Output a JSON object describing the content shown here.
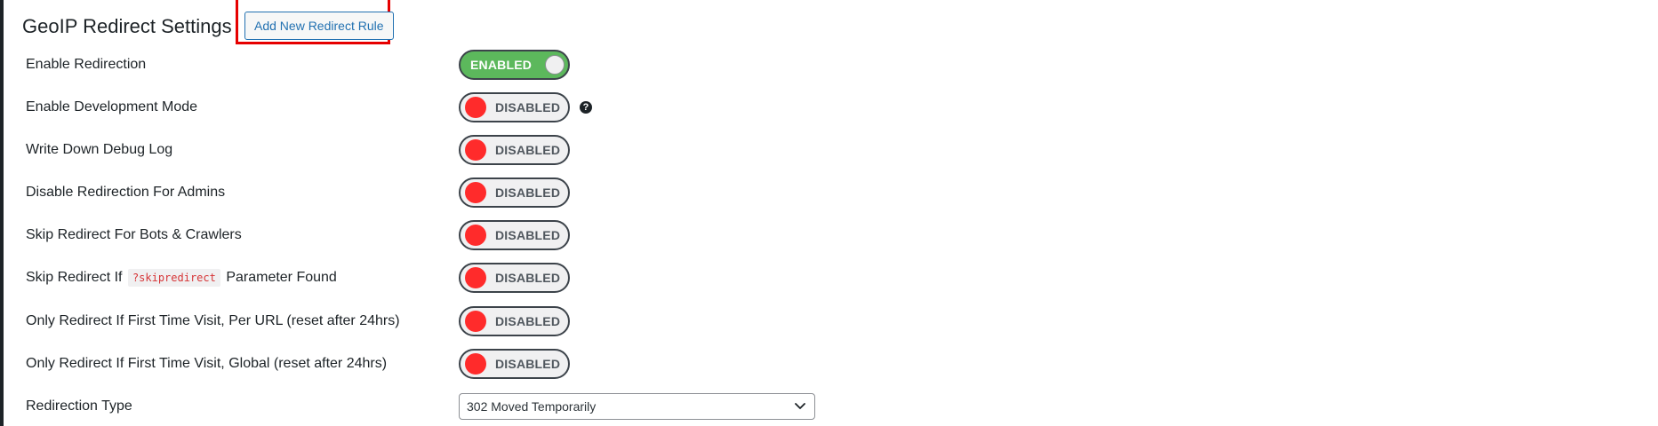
{
  "header": {
    "title": "GeoIP Redirect Settings",
    "add_rule_label": "Add New Redirect Rule"
  },
  "colors": {
    "enabled_toggle": "#5cb85c",
    "disabled_knob": "#ff2b2b",
    "highlight_box": "#e60000",
    "link_blue": "#2271b1"
  },
  "settings": {
    "enable_redirection": {
      "label": "Enable Redirection",
      "state": "ENABLED"
    },
    "development_mode": {
      "label": "Enable Development Mode",
      "state": "DISABLED",
      "help_icon": "question-circle-icon"
    },
    "debug_log": {
      "label": "Write Down Debug Log",
      "state": "DISABLED"
    },
    "disable_for_admins": {
      "label": "Disable Redirection For Admins",
      "state": "DISABLED"
    },
    "skip_bots": {
      "label": "Skip Redirect For Bots & Crawlers",
      "state": "DISABLED"
    },
    "skip_param": {
      "label_prefix": "Skip Redirect If",
      "code": "?skipredirect",
      "label_suffix": "Parameter Found",
      "state": "DISABLED"
    },
    "first_visit_per_url": {
      "label": "Only Redirect If First Time Visit, Per URL (reset after 24hrs)",
      "state": "DISABLED"
    },
    "first_visit_global": {
      "label": "Only Redirect If First Time Visit, Global (reset after 24hrs)",
      "state": "DISABLED"
    },
    "redirection_type": {
      "label": "Redirection Type",
      "selected": "302 Moved Temporarily",
      "icon": "chevron-down-icon"
    }
  }
}
